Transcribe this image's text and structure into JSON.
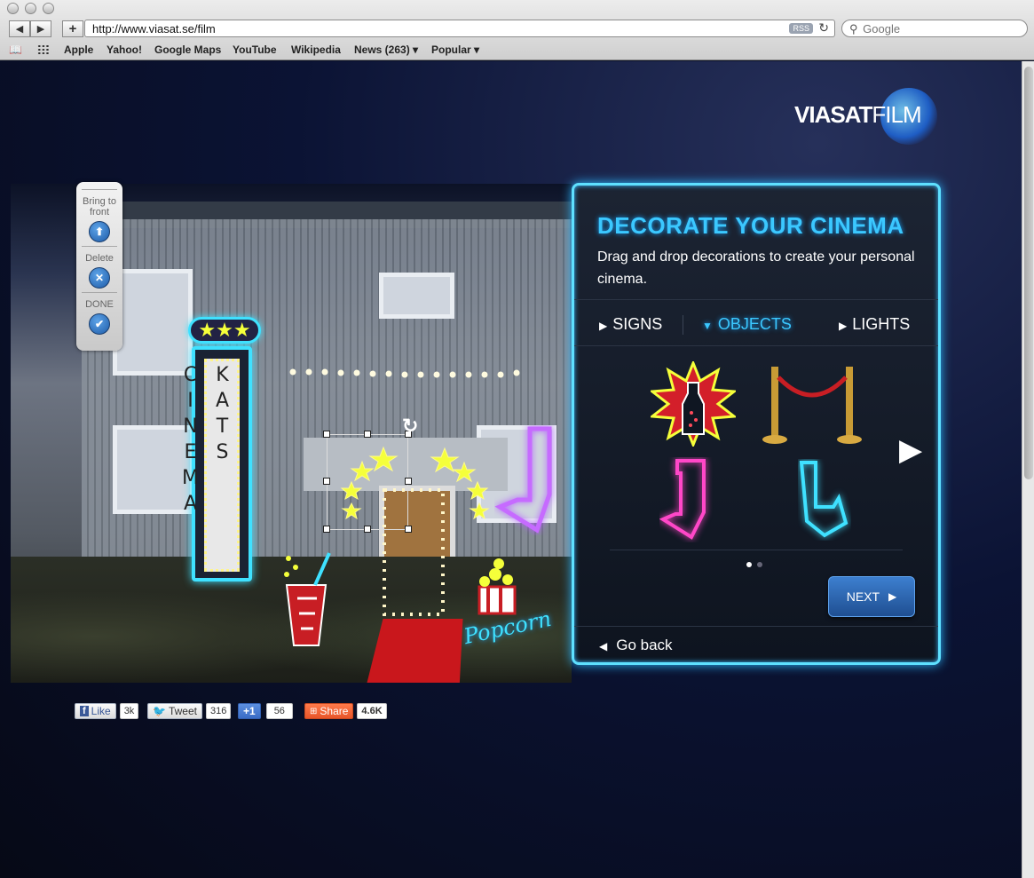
{
  "browser": {
    "url": "http://www.viasat.se/film",
    "rss": "RSS",
    "search_placeholder": "Google",
    "bookmarks": [
      "Apple",
      "Yahoo!",
      "Google Maps",
      "YouTube",
      "Wikipedia",
      "News (263) ▾",
      "Popular ▾"
    ]
  },
  "logo": {
    "brand": "VIASAT",
    "sub": "FILM"
  },
  "toolbar": {
    "bring_to_front": "Bring to front",
    "delete": "Delete",
    "done": "DONE"
  },
  "scene": {
    "marquee_text": "KATS CINEMA",
    "popcorn_text": "Popcorn"
  },
  "panel": {
    "title": "DECORATE YOUR CINEMA",
    "description": "Drag and drop decorations to create your personal cinema.",
    "tabs": [
      {
        "label": "SIGNS",
        "active": false
      },
      {
        "label": "OBJECTS",
        "active": true
      },
      {
        "label": "LIGHTS",
        "active": false
      }
    ],
    "next_label": "NEXT",
    "back_label": "Go back",
    "page_index": 1,
    "page_count": 2
  },
  "social": {
    "like": {
      "label": "Like",
      "count": "3k"
    },
    "tweet": {
      "label": "Tweet",
      "count": "316"
    },
    "plusone": {
      "label": "+1",
      "count": "56"
    },
    "share": {
      "label": "Share",
      "count": "4.6K"
    }
  },
  "colors": {
    "neon_blue": "#3bc8ff",
    "panel_border": "#5ee0ff",
    "carpet": "#c9171c",
    "next_button": "#2f6bbb"
  }
}
